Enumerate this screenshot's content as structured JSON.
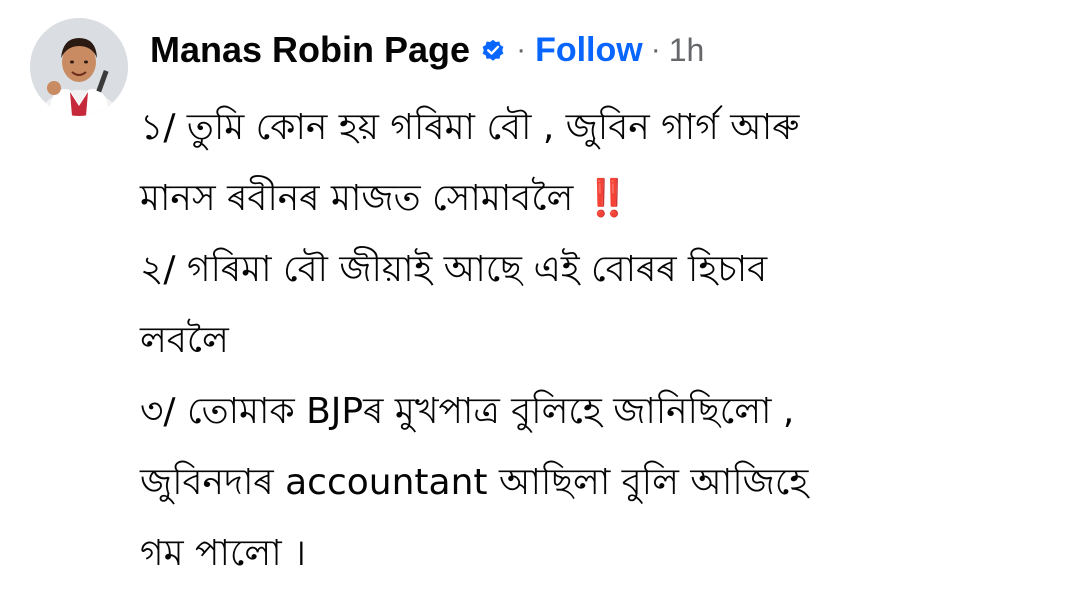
{
  "post": {
    "author": "Manas Robin Page",
    "separator": "·",
    "follow_label": "Follow",
    "timestamp": "1h",
    "verified_color": "#0866ff",
    "lines": [
      "১/ তুমি কোন হয় গৰিমা বৌ , জুবিন গাৰ্গ আৰু",
      "মানস ৰবীনৰ মাজত সোমাবলৈ",
      "২/ গৰিমা বৌ জীয়াই আছে এই বোৰৰ হিচাব",
      "লবলৈ",
      "৩/ তোমাক BJPৰ মুখপাত্ৰ বুলিহে জানিছিলো ,",
      "জুবিনদাৰ accountant আছিলা বুলি আজিহে",
      "গম পালো ।"
    ],
    "emphasis": "‼️"
  }
}
